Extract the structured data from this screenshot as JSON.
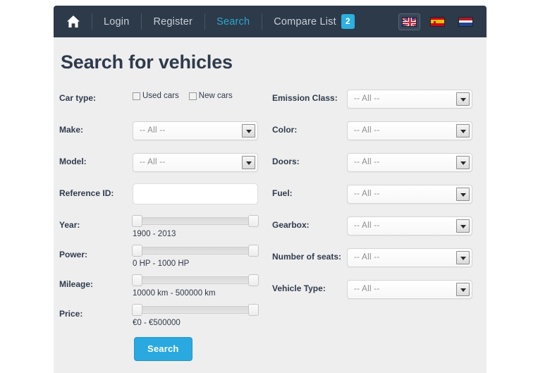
{
  "navbar": {
    "home_icon": "home-icon",
    "items": [
      {
        "label": "Login",
        "active": false
      },
      {
        "label": "Register",
        "active": false
      },
      {
        "label": "Search",
        "active": true
      },
      {
        "label": "Compare List",
        "active": false,
        "badge": "2"
      }
    ],
    "compare_badge": "2",
    "flags": [
      {
        "name": "flag-gb",
        "title": "English",
        "selected": true
      },
      {
        "name": "flag-es",
        "title": "Espanol",
        "selected": false
      },
      {
        "name": "flag-nl",
        "title": "Nederlands",
        "selected": false
      }
    ],
    "colors": {
      "background": "#2d3a4a",
      "active_link": "#2aa8cf",
      "badge": "#2bb0e0"
    }
  },
  "page": {
    "title": "Search for vehicles",
    "background": "#eeeeee"
  },
  "left_column": {
    "car_type": {
      "label": "Car type:",
      "options": [
        {
          "label": "Used cars",
          "checked": false
        },
        {
          "label": "New cars",
          "checked": false
        }
      ]
    },
    "make": {
      "label": "Make:",
      "value": "-- All --"
    },
    "model": {
      "label": "Model:",
      "value": "-- All --"
    },
    "reference_id": {
      "label": "Reference ID:",
      "value": "",
      "placeholder": ""
    },
    "year": {
      "label": "Year:",
      "range_text": "1900 - 2013",
      "min": "1900",
      "max": "2013"
    },
    "power": {
      "label": "Power:",
      "range_text": "0 HP - 1000 HP",
      "min": "0 HP",
      "max": "1000 HP"
    },
    "mileage": {
      "label": "Mileage:",
      "range_text": "10000 km - 500000 km",
      "min": "10000 km",
      "max": "500000 km"
    },
    "price": {
      "label": "Price:",
      "range_text": "€0 - €500000",
      "min": "€0",
      "max": "€500000"
    }
  },
  "right_column": {
    "emission_class": {
      "label": "Emission Class:",
      "value": "-- All --"
    },
    "color": {
      "label": "Color:",
      "value": "-- All --"
    },
    "doors": {
      "label": "Doors:",
      "value": "-- All --"
    },
    "fuel": {
      "label": "Fuel:",
      "value": "-- All --"
    },
    "gearbox": {
      "label": "Gearbox:",
      "value": "-- All --"
    },
    "number_of_seats": {
      "label": "Number of seats:",
      "value": "-- All --"
    },
    "vehicle_type": {
      "label": "Vehicle Type:",
      "value": "-- All --"
    }
  },
  "actions": {
    "search_label": "Search",
    "search_color": "#29a9df"
  }
}
